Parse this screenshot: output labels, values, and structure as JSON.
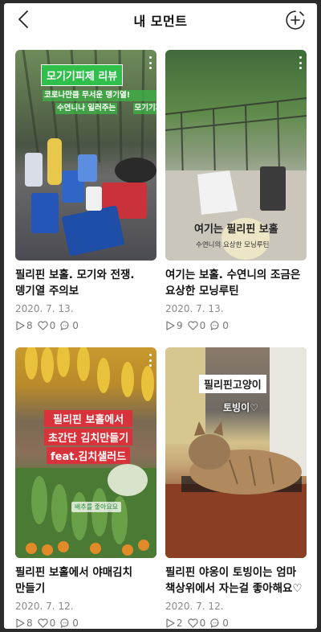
{
  "header": {
    "title": "내 모먼트",
    "back_icon": "back-chevron-icon",
    "add_icon": "add-circle-icon"
  },
  "posts": [
    {
      "title": "필리핀 보홀. 모기와 전쟁. 뎅기열 주의보",
      "date": "2020. 7. 13.",
      "plays": "8",
      "likes": "0",
      "comments": "0",
      "overlay": {
        "heading": "모기기피제 리뷰",
        "caption_line1": "코로나만큼 무서운 뎅기열!",
        "caption_line2": "수연니나 일러주는",
        "caption_line3": "모기기피제 리뷰"
      }
    },
    {
      "title": "여기는 보홀. 수연니의 조금은 요상한 모닝루틴",
      "date": "2020. 7. 13.",
      "plays": "9",
      "likes": "0",
      "comments": "0",
      "overlay": {
        "heading": "여기는 필리핀 보홀",
        "caption": "수연니의 요상한 모닝루틴"
      }
    },
    {
      "title": "필리핀 보홀에서 야매김치 만들기",
      "date": "2020. 7. 12.",
      "plays": "8",
      "likes": "0",
      "comments": "0",
      "overlay": {
        "line1": "필리핀 보홀에서",
        "line2": "초간단 김치만들기",
        "line3": "feat.김치샐러드",
        "tag": "배추를 좋아요요"
      }
    },
    {
      "title": "필리핀 야옹이 토빙이는 엄마 책상위에서 자는걸 좋아해요♡",
      "date": "2020. 7. 12.",
      "plays": "2",
      "likes": "0",
      "comments": "0",
      "overlay": {
        "heading": "필리핀고양이",
        "caption": "토빙이♡"
      }
    }
  ]
}
